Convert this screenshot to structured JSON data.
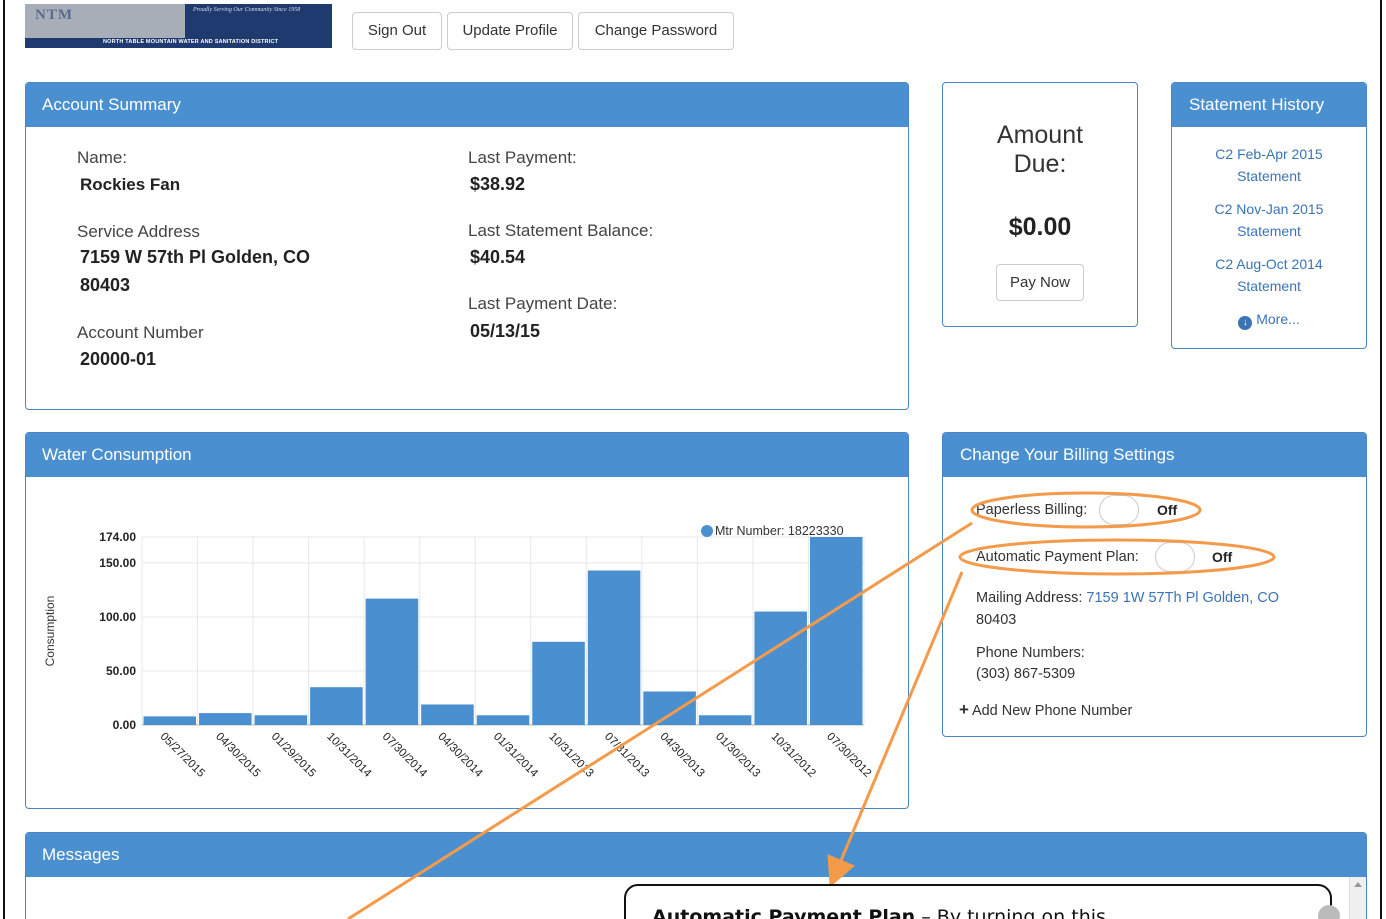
{
  "header": {
    "logo_text": "NTM",
    "logo_tagline": "Proudly Serving Our Community Since 1958",
    "logo_name": "NORTH TABLE MOUNTAIN WATER AND SANITATION DISTRICT",
    "buttons": [
      "Sign Out",
      "Update Profile",
      "Change Password"
    ]
  },
  "account_summary": {
    "title": "Account Summary",
    "name_label": "Name:",
    "name_value": "Rockies Fan",
    "address_label": "Service Address",
    "address_line1": "7159 W 57th Pl Golden, CO",
    "address_line2": "80403",
    "account_label": "Account Number",
    "account_value": "20000-01",
    "last_payment_label": "Last Payment:",
    "last_payment_value": "$38.92",
    "last_statement_label": "Last Statement Balance:",
    "last_statement_value": "$40.54",
    "last_payment_date_label": "Last Payment Date:",
    "last_payment_date_value": "05/13/15"
  },
  "amount_due": {
    "label_line1": "Amount",
    "label_line2": "Due:",
    "value": "$0.00",
    "pay_button": "Pay Now"
  },
  "statement_history": {
    "title": "Statement History",
    "items": [
      {
        "line1": "C2 Feb-Apr 2015",
        "line2": "Statement"
      },
      {
        "line1": "C2 Nov-Jan 2015",
        "line2": "Statement"
      },
      {
        "line1": "C2 Aug-Oct 2014",
        "line2": "Statement"
      }
    ],
    "more": "More..."
  },
  "water_consumption": {
    "title": "Water Consumption"
  },
  "chart_data": {
    "type": "bar",
    "ylabel": "Consumption",
    "xlabel": "",
    "ylim": [
      0,
      174
    ],
    "yticks": [
      "0.00",
      "50.00",
      "100.00",
      "150.00",
      "174.00"
    ],
    "ytick_values": [
      0,
      50,
      100,
      150,
      174
    ],
    "legend_position": "top-right",
    "color": "#4a90d0",
    "categories": [
      "05/27/2015",
      "04/30/2015",
      "01/29/2015",
      "10/31/2014",
      "07/30/2014",
      "04/30/2014",
      "01/31/2014",
      "10/31/2013",
      "07/31/2013",
      "04/30/2013",
      "01/30/2013",
      "10/31/2012",
      "07/30/2012"
    ],
    "series": [
      {
        "name": "Mtr Number: 18223330",
        "values": [
          8,
          11,
          9,
          35,
          117,
          19,
          9,
          77,
          143,
          31,
          9,
          105,
          174
        ]
      }
    ]
  },
  "billing_settings": {
    "title": "Change Your Billing Settings",
    "paperless_label": "Paperless Billing:",
    "paperless_state": "Off",
    "autopay_label": "Automatic Payment Plan:",
    "autopay_state": "Off",
    "mailing_label": "Mailing Address:",
    "mailing_value_line1": "7159 1W 57Th Pl Golden, CO",
    "mailing_value_line2": "80403",
    "phone_label": "Phone Numbers:",
    "phone_value": "(303) 867-5309",
    "add_phone": "Add New Phone Number"
  },
  "messages": {
    "title": "Messages"
  },
  "callout": {
    "bold": "Automatic Payment Plan",
    "text": " – By turning on this"
  },
  "annotation_color": "#f39a4b"
}
